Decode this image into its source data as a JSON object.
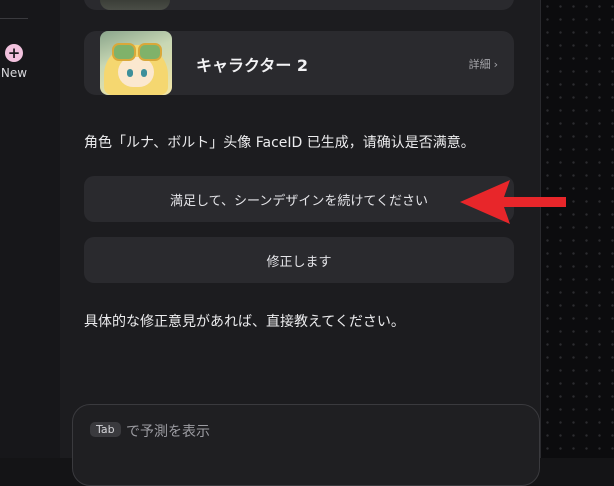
{
  "sidebar": {
    "new_label": "New",
    "plus_glyph": "+"
  },
  "character_card": {
    "name": "キャラクター 2",
    "detail_label": "詳細",
    "detail_chevron": "›"
  },
  "messages": {
    "confirmation": "角色「ルナ、ボルト」头像 FaceID 已生成，请确认是否满意。",
    "feedback_prompt": "具体的な修正意見があれば、直接教えてください。"
  },
  "options": {
    "continue_label": "満足して、シーンデザインを続けてください",
    "revise_label": "修正します"
  },
  "composer": {
    "tab_key": "Tab",
    "hint": "で予測を表示"
  },
  "colors": {
    "accent_pink": "#f2c2de",
    "annotation_arrow": "#e8262a",
    "button_bg": "#2a2a2e"
  },
  "icons": [
    "plus-icon",
    "chevron-right-icon",
    "red-arrow-annotation"
  ]
}
